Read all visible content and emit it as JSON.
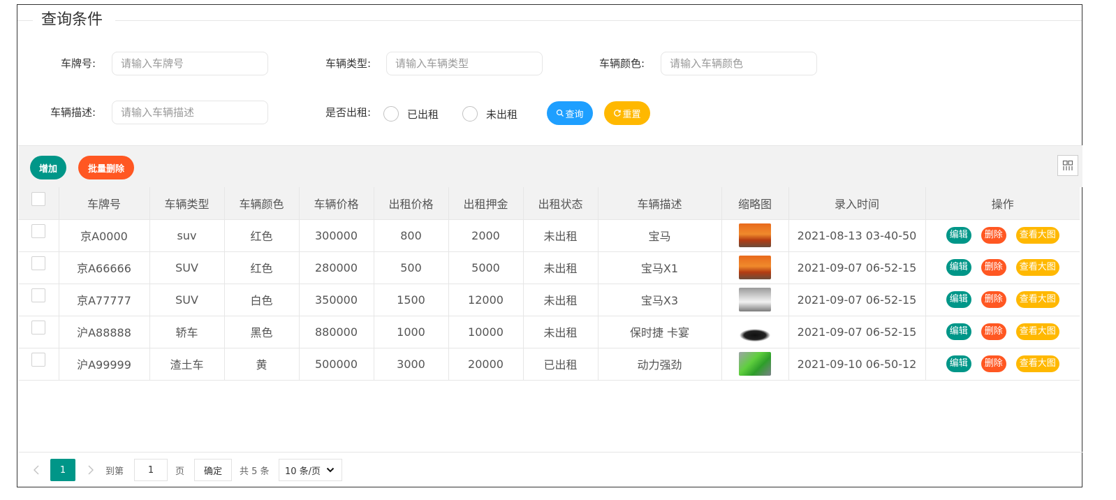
{
  "filter": {
    "legend": "查询条件",
    "plate_label": "车牌号:",
    "plate_placeholder": "请输入车牌号",
    "type_label": "车辆类型:",
    "type_placeholder": "请输入车辆类型",
    "color_label": "车辆颜色:",
    "color_placeholder": "请输入车辆颜色",
    "desc_label": "车辆描述:",
    "desc_placeholder": "请输入车辆描述",
    "rented_label": "是否出租:",
    "rented_options": [
      "已出租",
      "未出租"
    ],
    "search_label": "查询",
    "reset_label": "重置",
    "search_color": "#1e9fff",
    "reset_color": "#ffb800"
  },
  "toolbar": {
    "add_label": "增加",
    "batch_delete_label": "批量删除",
    "add_color": "#009688",
    "batch_delete_color": "#ff5722",
    "columns_icon": "grid-columns-icon"
  },
  "table": {
    "headers": [
      "车牌号",
      "车辆类型",
      "车辆颜色",
      "车辆价格",
      "出租价格",
      "出租押金",
      "出租状态",
      "车辆描述",
      "缩略图",
      "录入时间",
      "操作"
    ],
    "rows": [
      {
        "plate": "京A0000",
        "type": "suv",
        "color": "红色",
        "price": "300000",
        "rent_price": "800",
        "deposit": "2000",
        "status": "未出租",
        "desc": "宝马",
        "thumb": "orange-suv",
        "time": "2021-08-13 03-40-50"
      },
      {
        "plate": "京A66666",
        "type": "SUV",
        "color": "红色",
        "price": "280000",
        "rent_price": "500",
        "deposit": "5000",
        "status": "未出租",
        "desc": "宝马X1",
        "thumb": "orange-suv",
        "time": "2021-09-07 06-52-15"
      },
      {
        "plate": "京A77777",
        "type": "SUV",
        "color": "白色",
        "price": "350000",
        "rent_price": "1500",
        "deposit": "12000",
        "status": "未出租",
        "desc": "宝马X3",
        "thumb": "white-suv",
        "time": "2021-09-07 06-52-15"
      },
      {
        "plate": "沪A88888",
        "type": "轿车",
        "color": "黑色",
        "price": "880000",
        "rent_price": "1000",
        "deposit": "10000",
        "status": "未出租",
        "desc": "保时捷 卡宴",
        "thumb": "black-car",
        "time": "2021-09-07 06-52-15"
      },
      {
        "plate": "沪A99999",
        "type": "渣土车",
        "color": "黄",
        "price": "500000",
        "rent_price": "3000",
        "deposit": "20000",
        "status": "已出租",
        "desc": "动力强劲",
        "thumb": "green-truck",
        "time": "2021-09-10 06-50-12"
      }
    ],
    "actions": {
      "edit": "编辑",
      "delete": "删除",
      "view": "查看大图"
    },
    "status_colors": {
      "未出租": "#ff0000",
      "已出租": "#0000ff"
    }
  },
  "pager": {
    "current_page": "1",
    "goto_label": "到第",
    "goto_value": "1",
    "page_unit": "页",
    "confirm_label": "确定",
    "total_label": "共 5 条",
    "page_size_label": "10 条/页"
  }
}
